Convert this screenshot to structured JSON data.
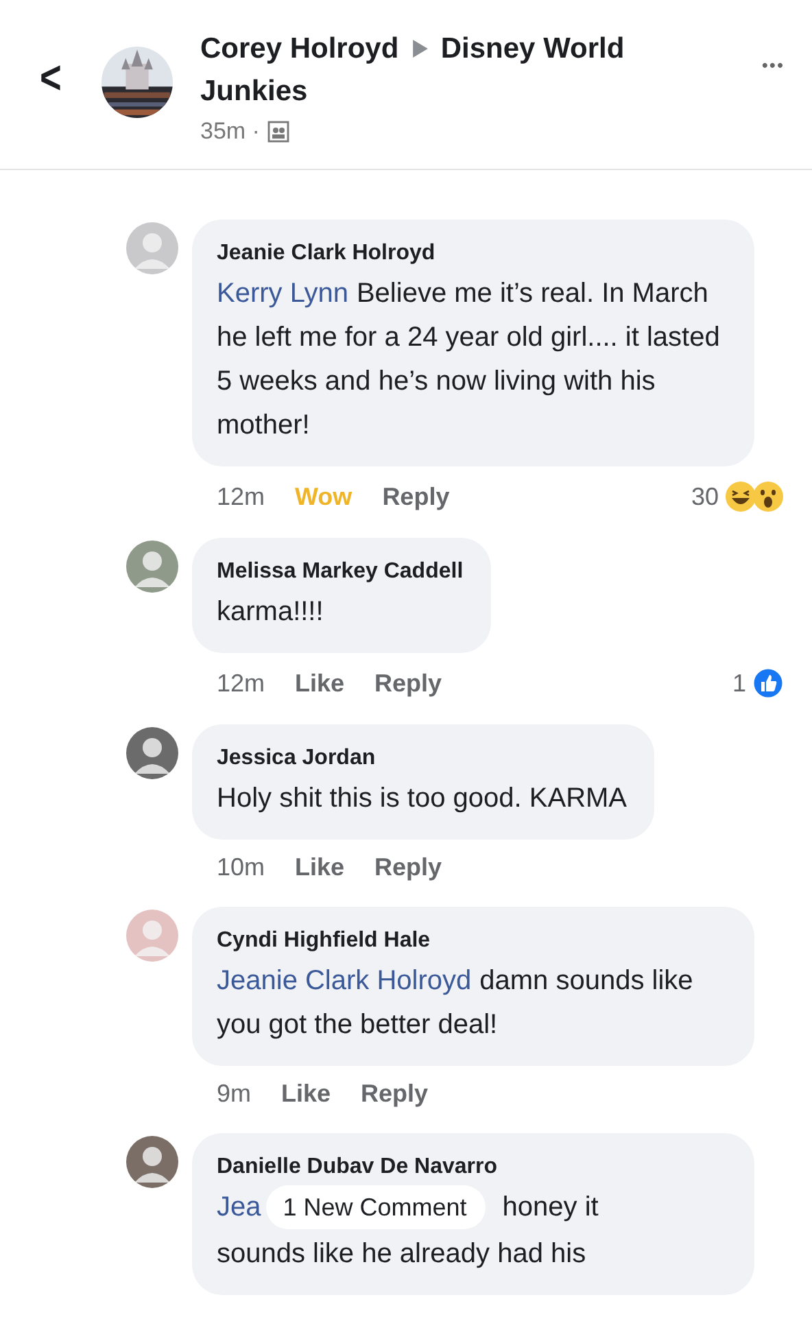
{
  "header": {
    "back": "<",
    "title_author": "Corey Holroyd",
    "title_group": "Disney World Junkies",
    "time": "35m ·",
    "more": "•••"
  },
  "comments": [
    {
      "name": "Jeanie Clark Holroyd",
      "mention": "Kerry Lynn",
      "text": "Believe me it’s real. In March he left me for a 24 year old girl.... it lasted 5 weeks and he’s now living with his mother!",
      "time": "12m",
      "reaction": {
        "label": "Wow",
        "kind": "wow"
      },
      "reply": "Reply",
      "count": "30",
      "reactions": [
        {
          "kind": "haha"
        },
        {
          "kind": "wow"
        }
      ]
    },
    {
      "name": "Melissa Markey Caddell",
      "text": "karma!!!!",
      "time": "12m",
      "reaction": {
        "label": "Like",
        "kind": "none"
      },
      "reply": "Reply",
      "count": "1",
      "reactions": [
        {
          "kind": "like"
        }
      ]
    },
    {
      "name": "Jessica Jordan",
      "text": "Holy shit this is too good. KARMA",
      "time": "10m",
      "reaction": {
        "label": "Like",
        "kind": "none"
      },
      "reply": "Reply"
    },
    {
      "name": "Cyndi Highfield Hale",
      "mention": "Jeanie Clark Holroyd",
      "text": "damn sounds like you got the better deal!",
      "time": "9m",
      "reaction": {
        "label": "Like",
        "kind": "none"
      },
      "reply": "Reply"
    },
    {
      "name": "Danielle Dubav De Navarro",
      "mention": "Jea",
      "overlay": "1 New Comment",
      "text": "honey it",
      "text_continued": "sounds like he already had his"
    }
  ]
}
